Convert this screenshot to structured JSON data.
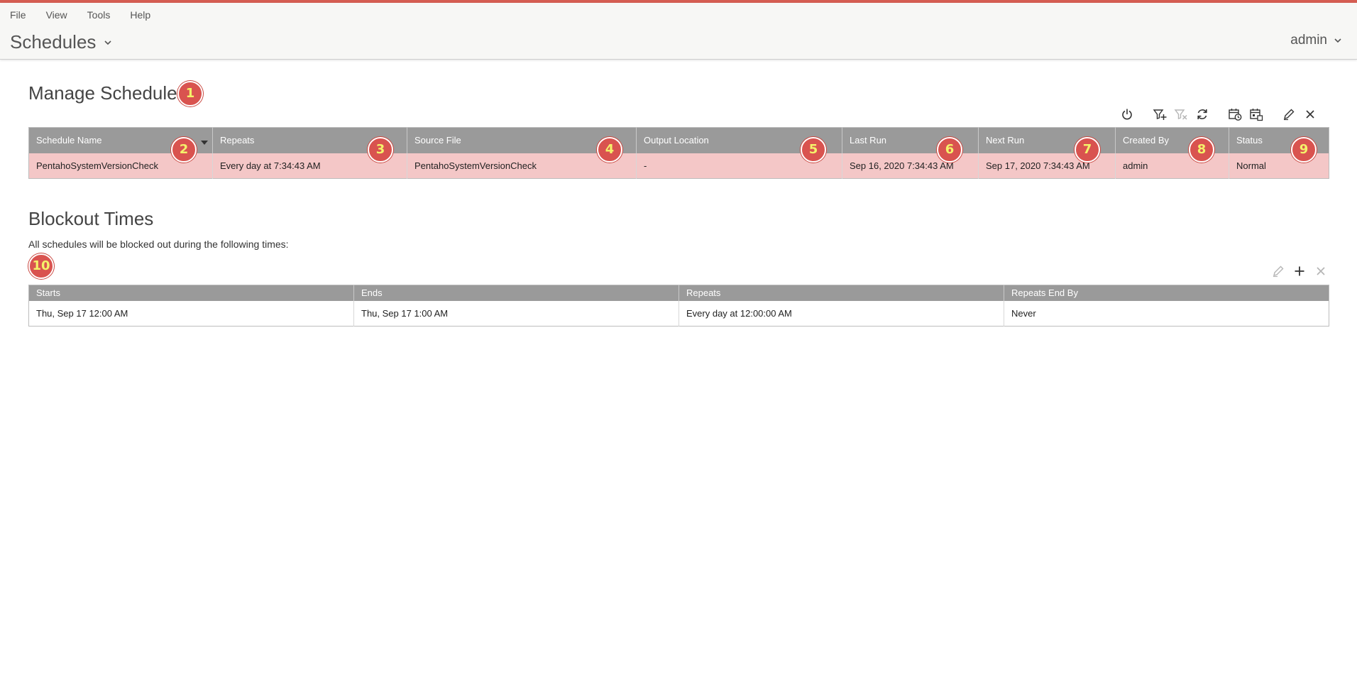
{
  "menu": [
    "File",
    "View",
    "Tools",
    "Help"
  ],
  "perspective": {
    "title": "Schedules"
  },
  "user": {
    "name": "admin"
  },
  "manage": {
    "title": "Manage Schedules",
    "toolbar_icons": [
      "power-icon",
      "filter-add-icon",
      "filter-remove-icon",
      "refresh-icon",
      "execute-schedule-icon",
      "schedule-blockout-icon",
      "edit-icon",
      "close-icon"
    ],
    "columns": [
      "Schedule Name",
      "Repeats",
      "Source File",
      "Output Location",
      "Last Run",
      "Next Run",
      "Created By",
      "Status"
    ],
    "rows": [
      [
        "PentahoSystemVersionCheck",
        "Every day at 7:34:43 AM",
        "PentahoSystemVersionCheck",
        "-",
        "Sep 16, 2020 7:34:43 AM",
        "Sep 17, 2020 7:34:43 AM",
        "admin",
        "Normal"
      ]
    ]
  },
  "blockout": {
    "title": "Blockout Times",
    "description": "All schedules will be blocked out during the following times:",
    "toolbar_icons": [
      "edit-icon",
      "add-icon",
      "close-icon"
    ],
    "columns": [
      "Starts",
      "Ends",
      "Repeats",
      "Repeats End By"
    ],
    "rows": [
      [
        "Thu, Sep 17 12:00 AM",
        "Thu, Sep 17 1:00 AM",
        "Every day at 12:00:00 AM",
        "Never"
      ]
    ]
  },
  "badges": [
    "1",
    "2",
    "3",
    "4",
    "5",
    "6",
    "7",
    "8",
    "9",
    "10"
  ],
  "colors": {
    "accent": "#d55d52",
    "badge": "#d9534f",
    "badge_text": "#f4f16a",
    "header_cell": "#9a9a9a",
    "selected_row": "#f4c7c7"
  }
}
